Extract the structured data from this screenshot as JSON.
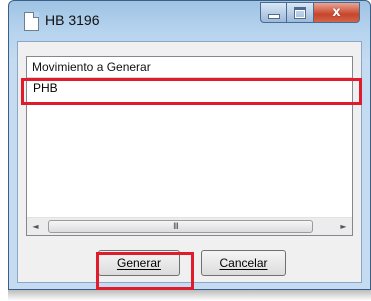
{
  "window": {
    "title": "HB 3196",
    "controls": {
      "minimize_icon": "minimize-icon",
      "maximize_icon": "maximize-icon",
      "close_label": "x"
    }
  },
  "list": {
    "header": "Movimiento a Generar",
    "items": [
      "PHB"
    ],
    "scrollbar": {
      "left_arrow": "◄",
      "right_arrow": "►",
      "grip": "III"
    }
  },
  "buttons": {
    "generar": "Generar",
    "cancelar": "Cancelar"
  },
  "colors": {
    "highlight": "#e01b2c",
    "close_button": "#c7452a"
  }
}
